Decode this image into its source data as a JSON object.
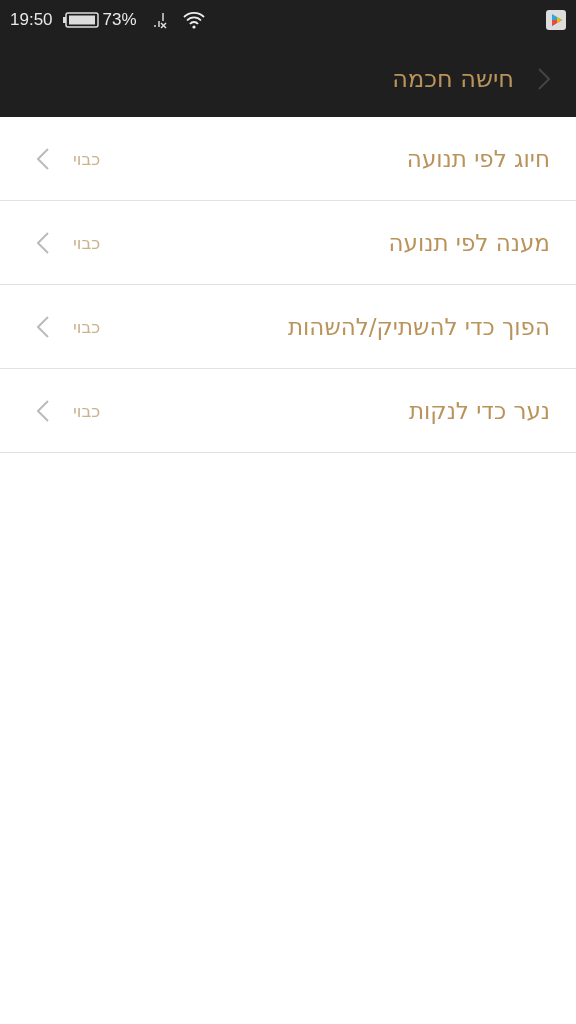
{
  "status_bar": {
    "time": "19:50",
    "battery": "73%"
  },
  "header": {
    "title": "חישה חכמה"
  },
  "items": [
    {
      "label": "חיוג לפי תנועה",
      "value": "כבוי"
    },
    {
      "label": "מענה לפי תנועה",
      "value": "כבוי"
    },
    {
      "label": "הפוך כדי להשתיק/להשהות",
      "value": "כבוי"
    },
    {
      "label": "נער כדי לנקות",
      "value": "כבוי"
    }
  ]
}
